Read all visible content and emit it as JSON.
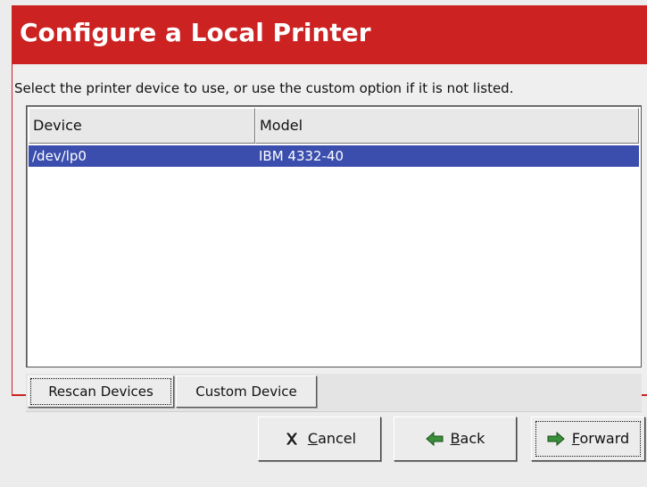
{
  "header": {
    "title": "Configure a Local Printer"
  },
  "instruction": "Select the printer device to use, or use the custom option if it is not listed.",
  "device_table": {
    "columns": [
      "Device",
      "Model"
    ],
    "rows": [
      {
        "device": "/dev/lp0",
        "model": "IBM 4332-40",
        "selected": true
      }
    ]
  },
  "table_buttons": {
    "rescan": "Rescan Devices",
    "custom": "Custom Device"
  },
  "nav_buttons": {
    "cancel": {
      "mnemonic": "C",
      "rest": "ancel",
      "icon": "cancel-x-icon"
    },
    "back": {
      "mnemonic": "B",
      "rest": "ack",
      "icon": "back-arrow-icon"
    },
    "forward": {
      "mnemonic": "F",
      "rest": "orward",
      "icon": "forward-arrow-icon"
    }
  },
  "colors": {
    "banner": "#cc2222",
    "selection": "#3b4eae",
    "arrow_icon": "#2e7d32"
  }
}
